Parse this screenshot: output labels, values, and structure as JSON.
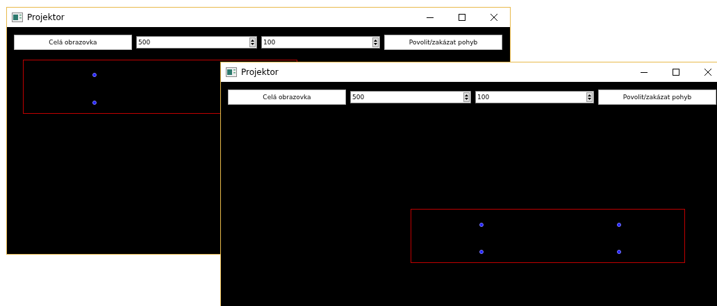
{
  "windows": [
    {
      "title": "Projektor",
      "toolbar": {
        "fullscreen_button": "Celá obrazovka",
        "spin_1": "500",
        "spin_2": "100",
        "toggle_button": "Povolit/zakázat pohyb"
      }
    },
    {
      "title": "Projektor",
      "toolbar": {
        "fullscreen_button": "Celá obrazovka",
        "spin_1": "500",
        "spin_2": "100",
        "toggle_button": "Povolit/zakázat pohyb"
      }
    }
  ]
}
